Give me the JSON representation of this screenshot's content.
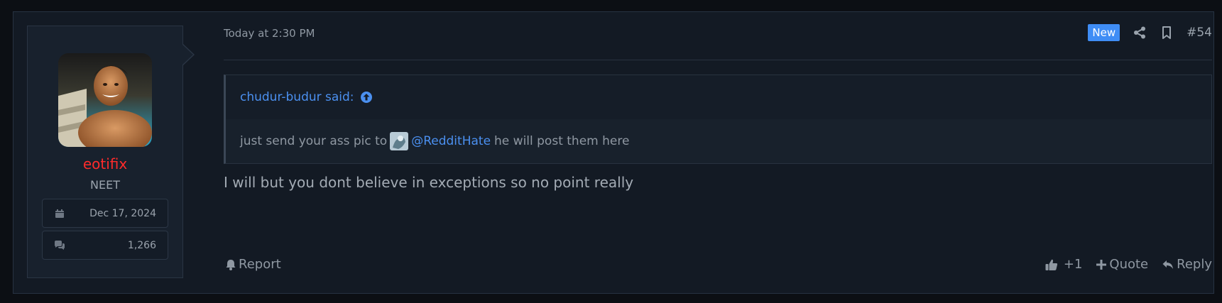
{
  "post": {
    "author": {
      "username": "eotifix",
      "title": "NEET",
      "joined": "Dec 17, 2024",
      "messages": "1,266",
      "username_color": "#ff2b2b"
    },
    "timestamp": "Today at 2:30 PM",
    "badge": "New",
    "post_number": "#54",
    "quote": {
      "author_said": "chudur-budur said:",
      "text_before": "just send your ass pic to",
      "mention": "@RedditHate",
      "text_after": "he will post them here"
    },
    "message": "I will but you dont believe in exceptions so no point really",
    "actions": {
      "report": "Report",
      "like_count": "+1",
      "quote": "Quote",
      "reply": "Reply"
    }
  },
  "colors": {
    "background": "#0c0f14",
    "panel": "#131a24",
    "accent": "#3f8df5",
    "link": "#4b90f0"
  }
}
